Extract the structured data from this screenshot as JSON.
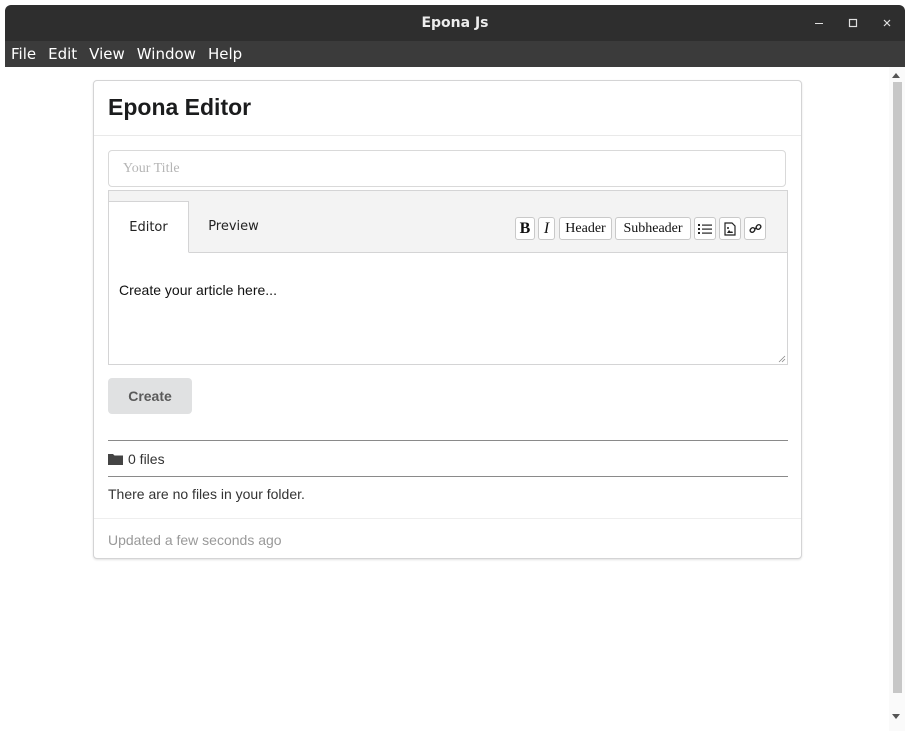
{
  "window": {
    "title": "Epona Js",
    "controls": {
      "minimize": "minimize",
      "maximize": "maximize",
      "close": "close"
    }
  },
  "menubar": {
    "items": [
      {
        "label": "File"
      },
      {
        "label": "Edit"
      },
      {
        "label": "View"
      },
      {
        "label": "Window"
      },
      {
        "label": "Help"
      }
    ]
  },
  "card": {
    "heading": "Epona Editor",
    "title_input": {
      "value": "",
      "placeholder": "Your Title"
    },
    "tabs": [
      {
        "label": "Editor",
        "active": true
      },
      {
        "label": "Preview",
        "active": false
      }
    ],
    "toolbar": {
      "bold": "B",
      "italic": "I",
      "header": "Header",
      "subheader": "Subheader",
      "icons": [
        "list-icon",
        "image-icon",
        "link-icon"
      ]
    },
    "editor_text": "Create your article here...",
    "create_label": "Create",
    "files_count": "0 files",
    "no_files_message": "There are no files in your folder.",
    "updated": "Updated a few seconds ago"
  },
  "colors": {
    "titlebar": "#2e2e2e",
    "menubar": "#3b3b3b",
    "button": "#e0e1e2"
  }
}
